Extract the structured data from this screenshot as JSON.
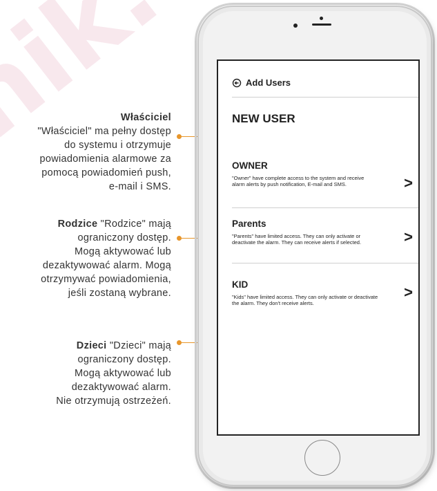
{
  "watermark": "nik.",
  "annotations": [
    {
      "title": "Właściciel",
      "lines": [
        "\"Właściciel\" ma pełny dostęp",
        "do systemu i otrzymuje",
        "powiadomienia alarmowe za",
        "pomocą powiadomień push,",
        "e-mail i SMS."
      ]
    },
    {
      "title": "Rodzice",
      "lines": [
        "\"Rodzice\" mają",
        "ograniczony dostęp.",
        "Mogą aktywować lub",
        "dezaktywować alarm. Mogą",
        "otrzymywać powiadomienia,",
        "jeśli zostaną wybrane."
      ]
    },
    {
      "title": "Dzieci",
      "lines": [
        "\"Dzieci\" mają",
        "ograniczony dostęp.",
        "Mogą aktywować lub",
        "dezaktywować alarm.",
        "Nie otrzymują ostrzeżeń."
      ]
    }
  ],
  "screen": {
    "header": "Add Users",
    "heading": "NEW USER",
    "options": [
      {
        "title": "OWNER",
        "desc": "\"Owner\" have complete access to the system and receive alarm alerts by push notification, E-mail and SMS."
      },
      {
        "title": "Parents",
        "desc": "\"Parents\" have limited access. They can only activate or deactivate the alarm. They can receive alerts if selected."
      },
      {
        "title": "KID",
        "desc": "\"Kids\" have limited access. They can only activate or deactivate the alarm. They don't receive alerts."
      }
    ],
    "chevron": ">"
  },
  "colors": {
    "accent": "#e8962b",
    "watermark": "#f3d6e0"
  }
}
